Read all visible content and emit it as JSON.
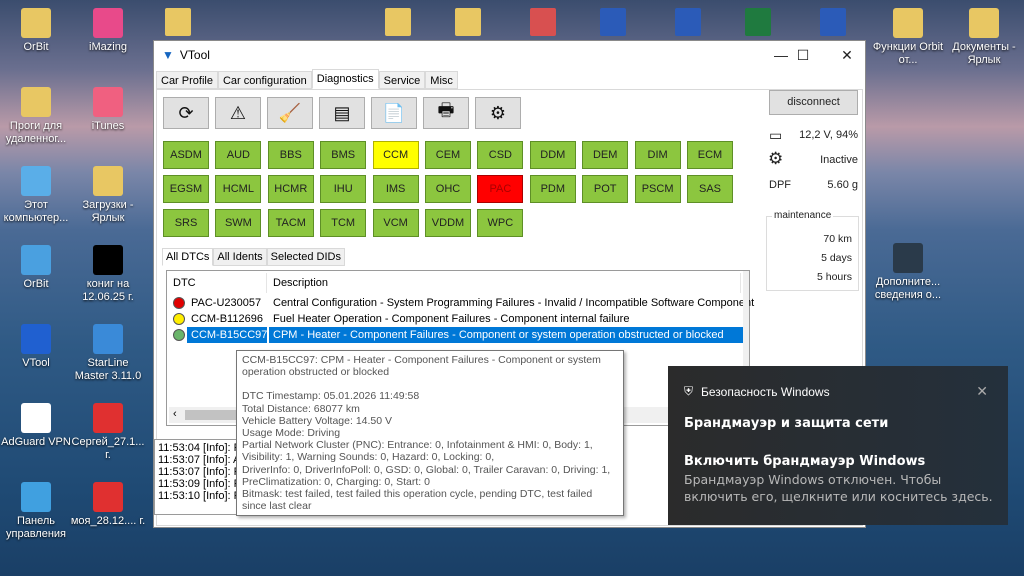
{
  "desktop": {
    "left_icons": [
      {
        "label": "OrBit",
        "color": "#e8c763"
      },
      {
        "label": "iMazing",
        "color": "#e84a8a"
      },
      {
        "label": "Проги для удаленног...",
        "color": "#e8c763"
      },
      {
        "label": "iTunes",
        "color": "#f06080"
      },
      {
        "label": "Этот компьютер...",
        "color": "#5aaee8"
      },
      {
        "label": "Загрузки - Ярлык",
        "color": "#e8c763"
      },
      {
        "label": "OrBit",
        "color": "#4aa0e0"
      },
      {
        "label": "кониг на 12.06.25 г.",
        "color": "#000000"
      },
      {
        "label": "VTool",
        "color": "#2060d0"
      },
      {
        "label": "StarLine Master 3.11.0",
        "color": "#3a8ad8"
      },
      {
        "label": "AdGuard VPN",
        "color": "#ffffff"
      },
      {
        "label": "Сергей_27.1... г.",
        "color": "#e03030"
      },
      {
        "label": "Панель управления",
        "color": "#40a0e0"
      },
      {
        "label": "моя_28.12.... г.",
        "color": "#e03030"
      }
    ],
    "right_icons": [
      {
        "label": "Функции Orbit от...",
        "color": "#e8c763"
      },
      {
        "label": "Документы - Ярлык",
        "color": "#e8c763"
      },
      {
        "label": "Дополните... сведения о...",
        "color": "#2a3a4a"
      }
    ],
    "top_icons": [
      "#e8c763",
      "#e8c763",
      "#e8c763",
      "#d85050",
      "#2b5bb8",
      "#2b5bb8",
      "#1f7a3f",
      "#2b5bb8",
      "#e8c763"
    ]
  },
  "window": {
    "title": "VTool",
    "tabs": [
      "Car Profile",
      "Car configuration",
      "Diagnostics",
      "Service",
      "Misc"
    ],
    "active_tab": "Diagnostics",
    "toolbar": [
      {
        "icon": "refresh-icon",
        "glyph": "⟳"
      },
      {
        "icon": "manual-warning-icon",
        "glyph": "⚠"
      },
      {
        "icon": "clean-icon",
        "glyph": "🧹"
      },
      {
        "icon": "obd-device-icon",
        "glyph": "▤"
      },
      {
        "icon": "report-icon",
        "glyph": "📄"
      },
      {
        "icon": "print-icon",
        "glyph": "🖶"
      },
      {
        "icon": "settings-icon",
        "glyph": "⚙"
      }
    ],
    "modules": [
      [
        "ASDM",
        "AUD",
        "BBS",
        "BMS",
        "CCM",
        "CEM",
        "CSD",
        "DDM",
        "DEM",
        "DIM",
        "ECM"
      ],
      [
        "EGSM",
        "HCML",
        "HCMR",
        "IHU",
        "IMS",
        "OHC",
        "PAC",
        "PDM",
        "POT",
        "PSCM",
        "SAS"
      ],
      [
        "SRS",
        "SWM",
        "TACM",
        "TCM",
        "VCM",
        "VDDM",
        "WPC"
      ]
    ],
    "module_status": {
      "CCM": "yellow",
      "PAC": "red"
    },
    "colors": {
      "ok": "#8cc63f",
      "warning": "#ffff00",
      "error": "#ff0000",
      "selection": "#0078d7"
    },
    "right_panel": {
      "disconnect": "disconnect",
      "battery": "12,2 V, 94%",
      "engine_status": "Inactive",
      "dpf_label": "DPF",
      "dpf_value": "5.60 g",
      "maintenance_title": "maintenance",
      "maintenance": [
        "70 km",
        "5 days",
        "5 hours"
      ]
    },
    "subtabs": [
      "All DTCs",
      "All Idents",
      "Selected DIDs"
    ],
    "dtc_columns": [
      "DTC",
      "Description"
    ],
    "dtcs": [
      {
        "code": "PAC-U230057",
        "desc": "Central Configuration - System Programming Failures - Invalid / Incompatible Software Component",
        "color": "#e00000"
      },
      {
        "code": "CCM-B112696",
        "desc": "Fuel Heater Operation - Component Failures - Component internal failure",
        "color": "#ffee00"
      },
      {
        "code": "CCM-B15CC97",
        "desc": "CPM - Heater - Component Failures - Component or system operation obstructed or blocked",
        "color": "#6bb56b"
      }
    ],
    "log": [
      "11:53:04 [Info]: Re",
      "11:53:07 [Info]: All",
      "11:53:07 [Info]: Re",
      "11:53:09 [Info]: Re",
      "11:53:10 [Info]: Fir"
    ],
    "tooltip": {
      "title": "CCM-B15CC97: CPM - Heater - Component Failures - Component or system operation obstructed or blocked",
      "lines": [
        "DTC Timestamp: 05.01.2026 11:49:58",
        "Total Distance: 68077 km",
        "Vehicle Battery Voltage: 14.50 V",
        "Usage Mode: Driving",
        "Partial Network Cluster (PNC): Entrance: 0, Infotainment & HMI: 0, Body: 1, Visibility: 1, Warning Sounds: 0, Hazard: 0, Locking: 0,",
        "DriverInfo: 0, DriverInfoPoll: 0, GSD: 0, Global: 0, Trailer Caravan: 0, Driving: 1, PreClimatization: 0, Charging: 0, Start: 0",
        "Bitmask: test failed, test failed this operation cycle, pending DTC, test failed since last clear"
      ]
    }
  },
  "toast": {
    "app": "Безопасность Windows",
    "heading": "Брандмауэр и защита сети",
    "title": "Включить брандмауэр Windows",
    "body": "Брандмауэр Windows отключен. Чтобы включить его, щелкните или коснитесь здесь."
  }
}
